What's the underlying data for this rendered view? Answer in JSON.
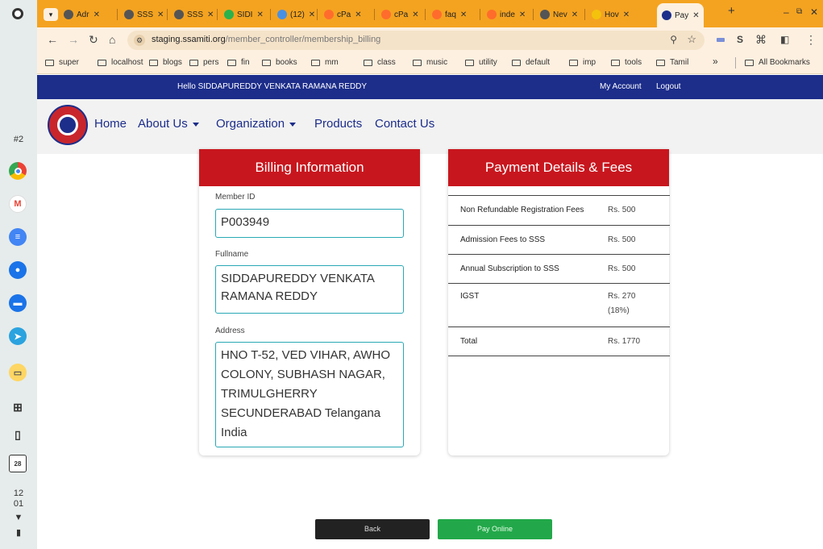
{
  "shelf": {
    "badge": "#2",
    "clock_hour": "12",
    "clock_min": "01",
    "calendar_day": "28"
  },
  "browser": {
    "tabs": [
      {
        "label": "Adr",
        "icon_color": "#555"
      },
      {
        "label": "SSS",
        "icon_color": "#555"
      },
      {
        "label": "SSS",
        "icon_color": "#555"
      },
      {
        "label": "SIDI",
        "icon_color": "#2bb24c"
      },
      {
        "label": "(12)",
        "icon_color": "#4a90e2"
      },
      {
        "label": "cPa",
        "icon_color": "#ff6c2c"
      },
      {
        "label": "cPa",
        "icon_color": "#ff6c2c"
      },
      {
        "label": "faq",
        "icon_color": "#ff6c2c"
      },
      {
        "label": "inde",
        "icon_color": "#ff6c2c"
      },
      {
        "label": "Nev",
        "icon_color": "#555"
      },
      {
        "label": "Hov",
        "icon_color": "#f4c20d"
      },
      {
        "label": "Pay",
        "icon_color": "#1c2d8a"
      }
    ],
    "url_host": "staging.ssamiti.org",
    "url_path": "/member_controller/membership_billing",
    "bookmarks": [
      "super",
      "localhost",
      "blogs",
      "pers",
      "fin",
      "books",
      "mm",
      "class",
      "music",
      "utility",
      "default",
      "imp",
      "tools",
      "Tamil"
    ],
    "all_bookmarks": "All Bookmarks",
    "overflow": "»"
  },
  "site": {
    "greeting": "Hello SIDDAPUREDDY VENKATA RAMANA REDDY",
    "my_account": "My Account",
    "logout": "Logout",
    "nav": {
      "home": "Home",
      "about": "About Us",
      "organization": "Organization",
      "products": "Products",
      "contact": "Contact Us"
    },
    "billing": {
      "title": "Billing Information",
      "member_id_label": "Member ID",
      "member_id": "P003949",
      "fullname_label": "Fullname",
      "fullname_line1": "SIDDAPUREDDY VENKATA",
      "fullname_line2": "RAMANA REDDY",
      "address_label": "Address",
      "address_lines": [
        "HNO T-52, VED VIHAR, AWHO",
        "COLONY, SUBHASH NAGAR,",
        "TRIMULGHERRY",
        "SECUNDERABAD  Telangana",
        "India"
      ]
    },
    "payment": {
      "title": "Payment Details & Fees",
      "rows": [
        {
          "name": "Non Refundable Registration Fees",
          "amount": "Rs. 500",
          "note": ""
        },
        {
          "name": "Admission Fees to SSS",
          "amount": "Rs. 500",
          "note": ""
        },
        {
          "name": "Annual Subscription to SSS",
          "amount": "Rs. 500",
          "note": ""
        },
        {
          "name": "IGST",
          "amount": "Rs. 270",
          "note": "(18%)"
        },
        {
          "name": "Total",
          "amount": "Rs. 1770",
          "note": ""
        }
      ]
    },
    "buttons": {
      "back": "Back",
      "pay": "Pay Online"
    }
  },
  "colors": {
    "tabstrip": "#f4a320",
    "topbar": "#1c2d8a",
    "card_header": "#c8161e",
    "pay_button": "#22a84a",
    "back_button": "#222222",
    "field_border": "#29a8b5"
  }
}
